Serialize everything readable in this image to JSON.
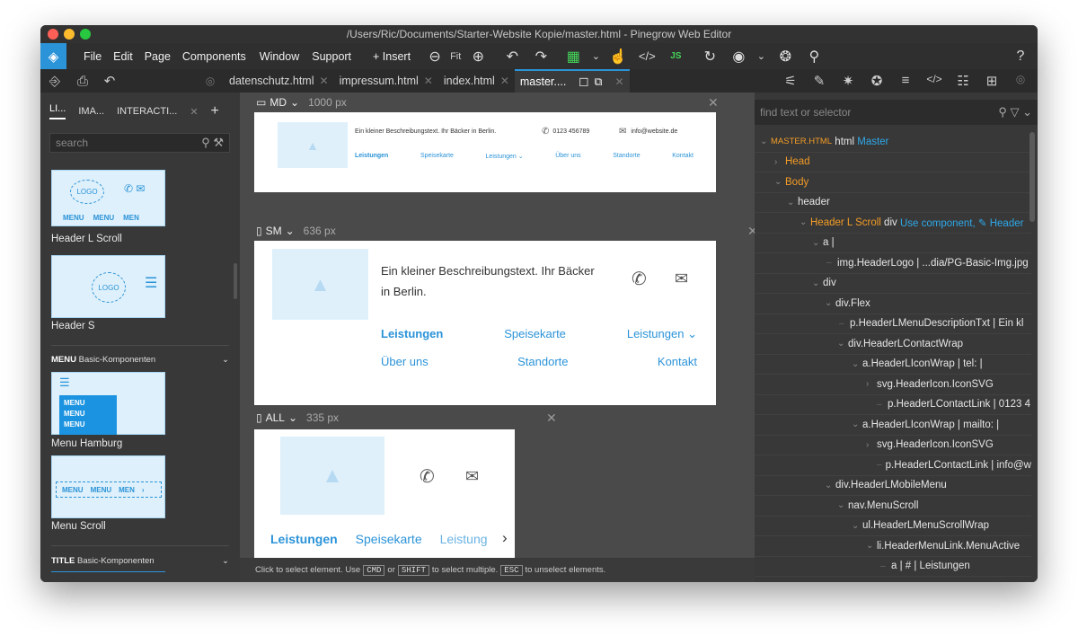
{
  "titlebar": {
    "path": "/Users/Ric/Documents/Starter-Website Kopie/master.html - Pinegrow Web Editor"
  },
  "menu": [
    "File",
    "Edit",
    "Page",
    "Components",
    "Window",
    "Support"
  ],
  "toolbar": {
    "insert_label": "+ Insert",
    "fit_label": "Fit"
  },
  "tabs": [
    {
      "label": "datenschutz.html"
    },
    {
      "label": "impressum.html"
    },
    {
      "label": "index.html"
    },
    {
      "label": "master...."
    }
  ],
  "left_panel": {
    "tabs": [
      "LI...",
      "IMA...",
      "INTERACTI..."
    ],
    "search_placeholder": "search",
    "components": [
      {
        "name": "Header L Scroll"
      },
      {
        "name": "Header S"
      },
      {
        "name": "Menu Hamburg"
      },
      {
        "name": "Menu Scroll"
      }
    ],
    "sections": [
      {
        "title": "MENU",
        "subtitle": "Basic-Komponenten"
      },
      {
        "title": "TITLE",
        "subtitle": "Basic-Komponenten"
      }
    ],
    "thumb_text": {
      "logo": "LOGO",
      "menu": "MENU",
      "menu_cut": "MEN"
    }
  },
  "viewports": [
    {
      "size": "MD",
      "width": "1000 px"
    },
    {
      "size": "SM",
      "width": "636 px"
    },
    {
      "size": "ALL",
      "width": "335 px"
    }
  ],
  "site": {
    "description": "Ein kleiner Beschreibungstext. Ihr Bäcker in Berlin.",
    "description_line1": "Ein kleiner Beschreibungstext. Ihr Bäcker",
    "description_line2": "in Berlin.",
    "phone": "0123 456789",
    "email": "info@website.de",
    "nav": [
      "Leistungen",
      "Speisekarte",
      "Leistungen",
      "Über uns",
      "Standorte",
      "Kontakt"
    ],
    "nav_cut": "Leistung"
  },
  "status": {
    "text1": "Click to select element. Use",
    "k1": "CMD",
    "or": "or",
    "k2": "SHIFT",
    "text2": "to select multiple.",
    "k3": "ESC",
    "text3": "to unselect elements."
  },
  "right_panel": {
    "search_placeholder": "find text or selector",
    "tree": [
      {
        "a": "MASTER.HTML",
        "b": "html",
        "c": "Master"
      },
      {
        "a": "Head"
      },
      {
        "a": "Body"
      },
      {
        "a": "header"
      },
      {
        "a": "Header L Scroll",
        "b": "div",
        "c": "Use component, ✎ Header"
      },
      {
        "a": "a |"
      },
      {
        "a": "img.HeaderLogo | ...dia/PG-Basic-Img.jpg"
      },
      {
        "a": "div"
      },
      {
        "a": "div.Flex"
      },
      {
        "a": "p.HeaderLMenuDescriptionTxt | Ein kl"
      },
      {
        "a": "div.HeaderLContactWrap"
      },
      {
        "a": "a.HeaderLIconWrap | tel: |"
      },
      {
        "a": "svg.HeaderIcon.IconSVG"
      },
      {
        "a": "p.HeaderLContactLink | 0123 4"
      },
      {
        "a": "a.HeaderLIconWrap | mailto: |"
      },
      {
        "a": "svg.HeaderIcon.IconSVG"
      },
      {
        "a": "p.HeaderLContactLink | info@w"
      },
      {
        "a": "div.HeaderLMobileMenu"
      },
      {
        "a": "nav.MenuScroll"
      },
      {
        "a": "ul.HeaderLMenuScrollWrap"
      },
      {
        "a": "li.HeaderMenuLink.MenuActive"
      },
      {
        "a": "a | # | Leistungen"
      }
    ]
  },
  "colors": {
    "accent": "#2b93d8",
    "placeholder": "#dff0fb",
    "tree_orange": "#f39c26"
  }
}
